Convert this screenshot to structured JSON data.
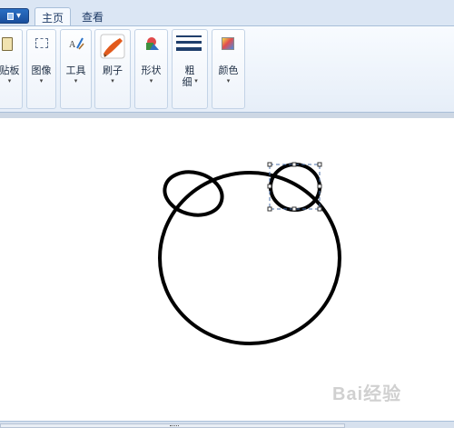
{
  "tabs": {
    "file_label": "▾",
    "home": "主页",
    "view": "查看"
  },
  "ribbon": {
    "clipboard": "贴板",
    "image": "图像",
    "tools": "工具",
    "brushes": "刷子",
    "shapes": "形状",
    "size_line1": "粗",
    "size_line2": "细",
    "colors": "颜色",
    "dropdown_arrow": "▾"
  },
  "canvas": {
    "shapes": [
      "large-circle",
      "left-ear-ellipse",
      "right-ear-ellipse-selected"
    ]
  },
  "watermark": "Bai经验",
  "colors": {
    "ribbon_bg": "#e6eef8",
    "accent_blue": "#1a4f9c",
    "stroke": "#000000"
  }
}
